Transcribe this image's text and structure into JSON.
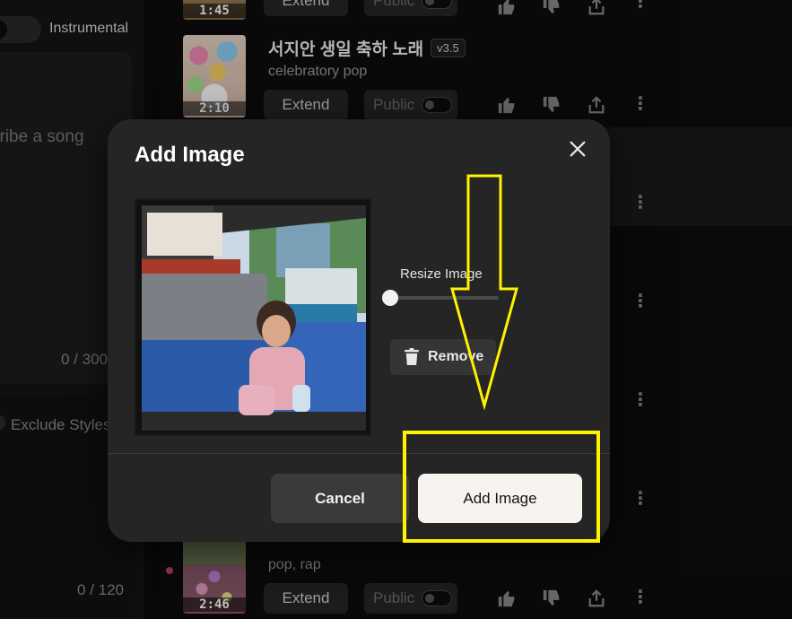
{
  "left_panel": {
    "instrumental_label": "Instrumental",
    "prompt_placeholder": "cribe a song",
    "prompt_char_count": "0 / 300",
    "exclude_styles_label": "Exclude Styles",
    "exclude_char_count": "0 / 120"
  },
  "songs": [
    {
      "duration": "1:45",
      "extend_label": "Extend",
      "public_label": "Public"
    },
    {
      "duration": "2:10",
      "title": "서지안 생일 축하 노래",
      "version": "v3.5",
      "genre": "celebratory pop",
      "extend_label": "Extend",
      "public_label": "Public"
    },
    {
      "duration": "2:46",
      "genre": "pop, rap",
      "extend_label": "Extend",
      "public_label": "Public"
    }
  ],
  "modal": {
    "title": "Add Image",
    "resize_label": "Resize Image",
    "resize_value": 0,
    "remove_label": "Remove",
    "cancel_label": "Cancel",
    "add_label": "Add Image"
  },
  "colors": {
    "modal_bg": "#252525",
    "primary_button": "#f7f3ef",
    "annotation": "#fff200"
  },
  "icons": [
    "close-icon",
    "trash-icon",
    "thumbs-up-icon",
    "thumbs-down-icon",
    "share-icon",
    "more-icon"
  ]
}
